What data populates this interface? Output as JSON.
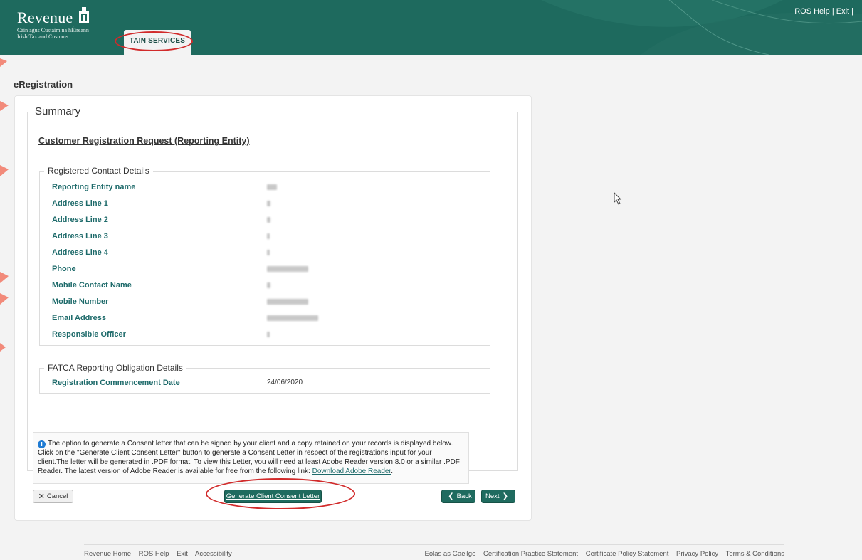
{
  "header": {
    "brand_word": "Revenue",
    "brand_sub1": "Cáin agus Custaim na hÉireann",
    "brand_sub2": "Irish Tax and Customs",
    "tab_label": "TAIN SERVICES",
    "help_link": "ROS Help",
    "exit_link": "Exit",
    "separator": "|",
    "trailing_separator": "|"
  },
  "page": {
    "title": "eRegistration"
  },
  "summary": {
    "legend": "Summary",
    "request_title": "Customer Registration Request (Reporting Entity)",
    "contact_section": {
      "legend": "Registered Contact Details",
      "rows": [
        {
          "label": "Reporting Entity name"
        },
        {
          "label": "Address Line 1"
        },
        {
          "label": "Address Line 2"
        },
        {
          "label": "Address Line 3"
        },
        {
          "label": "Address Line 4"
        },
        {
          "label": "Phone"
        },
        {
          "label": "Mobile Contact Name"
        },
        {
          "label": "Mobile Number"
        },
        {
          "label": "Email Address"
        },
        {
          "label": "Responsible Officer"
        }
      ]
    },
    "fatca_section": {
      "legend": "FATCA Reporting Obligation Details",
      "rows": [
        {
          "label": "Registration Commencement Date",
          "value": "24/06/2020"
        }
      ]
    }
  },
  "info": {
    "icon": "info-icon",
    "text": "The option to generate a Consent letter that can be signed by your client and a copy retained on your records is displayed below. Click on the \"Generate Client Consent Letter\" button to generate a Consent Letter in respect of the registrations input for your client.The letter will be generated in .PDF format. To view this Letter, you will need at least Adobe Reader version 8.0 or a similar .PDF Reader. The latest version of Adobe Reader is available for free from the following link: ",
    "link": "Download Adobe Reader",
    "link_suffix": "."
  },
  "buttons": {
    "cancel": "Cancel",
    "generate": "Generate Client Consent Letter",
    "back": "Back",
    "next": "Next"
  },
  "footer": {
    "left": [
      "Revenue Home",
      "ROS Help",
      "Exit",
      "Accessibility"
    ],
    "right": [
      "Eolas as Gaeilge",
      "Certification Practice Statement",
      "Certificate Policy Statement",
      "Privacy Policy",
      "Terms & Conditions"
    ]
  },
  "colors": {
    "header_green": "#1e6a5e",
    "label_teal": "#1d6a6a",
    "button_green": "#1f6b5f",
    "annotation_red": "#d12a2a"
  }
}
